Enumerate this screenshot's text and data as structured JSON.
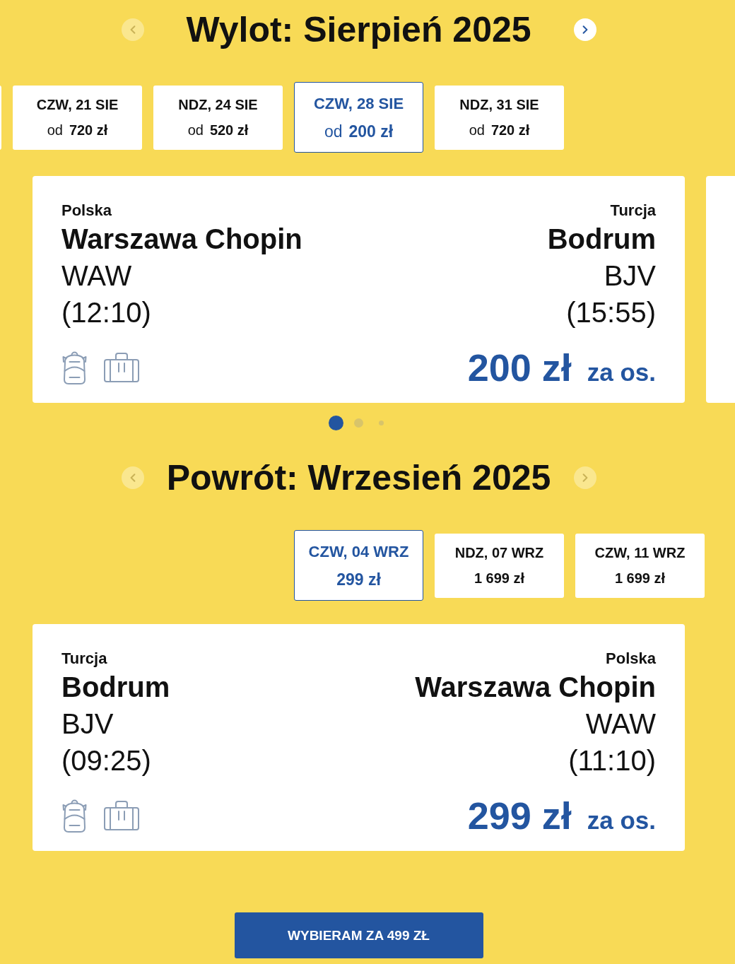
{
  "outbound": {
    "prev_arrow": {
      "disabled": true
    },
    "title": "Wylot: Sierpień 2025",
    "next_arrow": {
      "disabled": false
    },
    "dates": [
      {
        "kind": "edge",
        "selected": false
      },
      {
        "kind": "full",
        "day": "CZW, 21 SIE",
        "prefix": "od",
        "price": "720 zł",
        "selected": false
      },
      {
        "kind": "full",
        "day": "NDZ, 24 SIE",
        "prefix": "od",
        "price": "520 zł",
        "selected": false
      },
      {
        "kind": "full",
        "day": "CZW, 28 SIE",
        "prefix": "od",
        "price": "200 zł",
        "selected": true
      },
      {
        "kind": "full",
        "day": "NDZ, 31 SIE",
        "prefix": "od",
        "price": "720 zł",
        "selected": false
      }
    ],
    "flights": [
      {
        "kind": "full",
        "origin": {
          "country": "Polska",
          "airport": "Warszawa Chopin",
          "code": "WAW",
          "time": "(12:10)"
        },
        "destination": {
          "country": "Turcja",
          "airport": "Bodrum",
          "code": "BJV",
          "time": "(15:55)"
        },
        "price": "200 zł",
        "price_unit": "za os."
      },
      {
        "kind": "edge"
      }
    ],
    "pager": [
      {
        "selected": true
      },
      {
        "selected": false
      },
      {
        "selected": false
      }
    ]
  },
  "return": {
    "prev_arrow": {
      "disabled": true
    },
    "title": "Powrót: Wrzesień 2025",
    "next_arrow": {
      "disabled": true
    },
    "dates": [
      {
        "kind": "full",
        "day": "CZW, 04 WRZ",
        "price": "299 zł",
        "selected": true
      },
      {
        "kind": "full",
        "day": "NDZ, 07 WRZ",
        "price": "1 699 zł",
        "selected": false
      },
      {
        "kind": "full",
        "day": "CZW, 11 WRZ",
        "price": "1 699 zł",
        "selected": false
      }
    ],
    "flights": [
      {
        "kind": "full",
        "origin": {
          "country": "Turcja",
          "airport": "Bodrum",
          "code": "BJV",
          "time": "(09:25)"
        },
        "destination": {
          "country": "Polska",
          "airport": "Warszawa Chopin",
          "code": "WAW",
          "time": "(11:10)"
        },
        "price": "299 zł",
        "price_unit": "za os."
      }
    ]
  },
  "select_button": {
    "label": "WYBIERAM ZA 499 ZŁ"
  }
}
